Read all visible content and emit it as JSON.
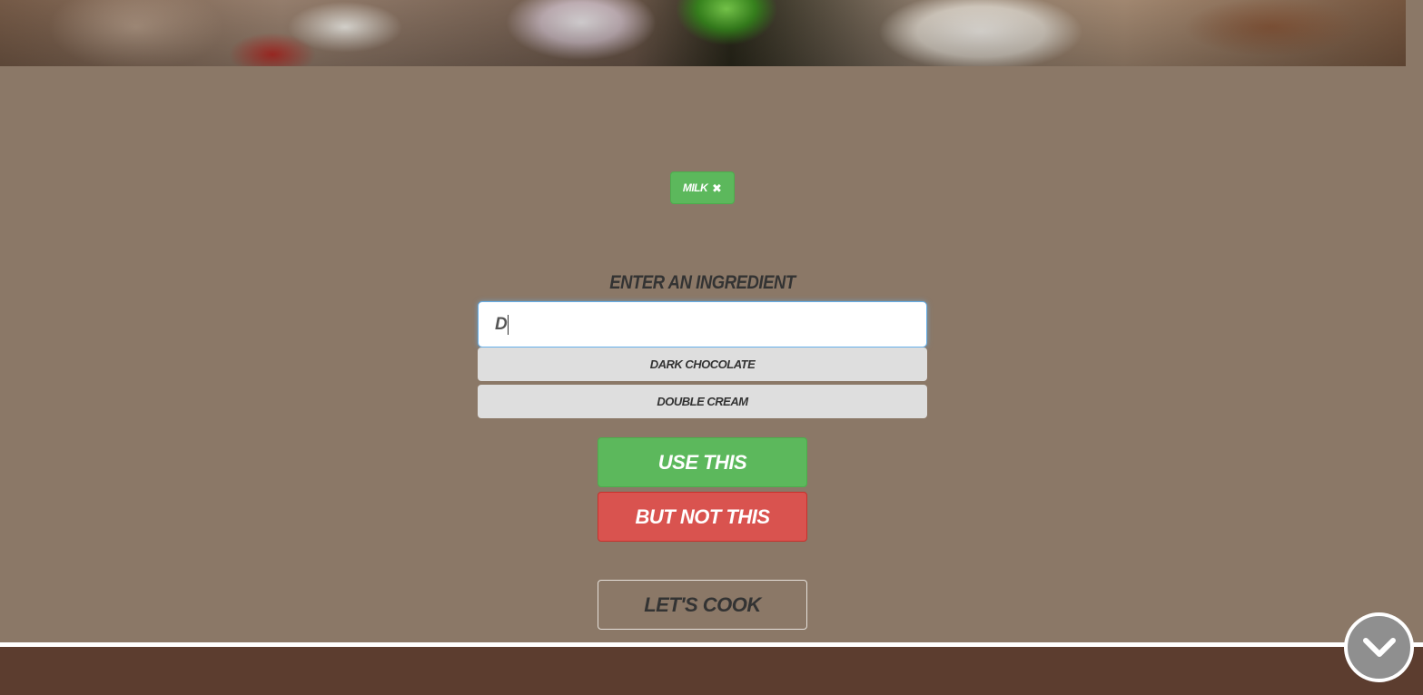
{
  "hero": {
    "alt": "ingredients photo"
  },
  "selected_ingredients": [
    {
      "label": "MILK",
      "remove_icon": "close-icon"
    }
  ],
  "form": {
    "label": "ENTER AN INGREDIENT",
    "input_value": "D",
    "suggestions": [
      "DARK CHOCOLATE",
      "DOUBLE CREAM"
    ],
    "use_label": "USE THIS",
    "exclude_label": "BUT NOT THIS",
    "cook_label": "LET'S COOK"
  },
  "scroll_button": {
    "icon": "chevron-down-icon"
  },
  "colors": {
    "background": "#8b7867",
    "success": "#5cb85c",
    "danger": "#d9534f",
    "footer": "#5c3d2f",
    "suggestion_bg": "#dedede"
  }
}
